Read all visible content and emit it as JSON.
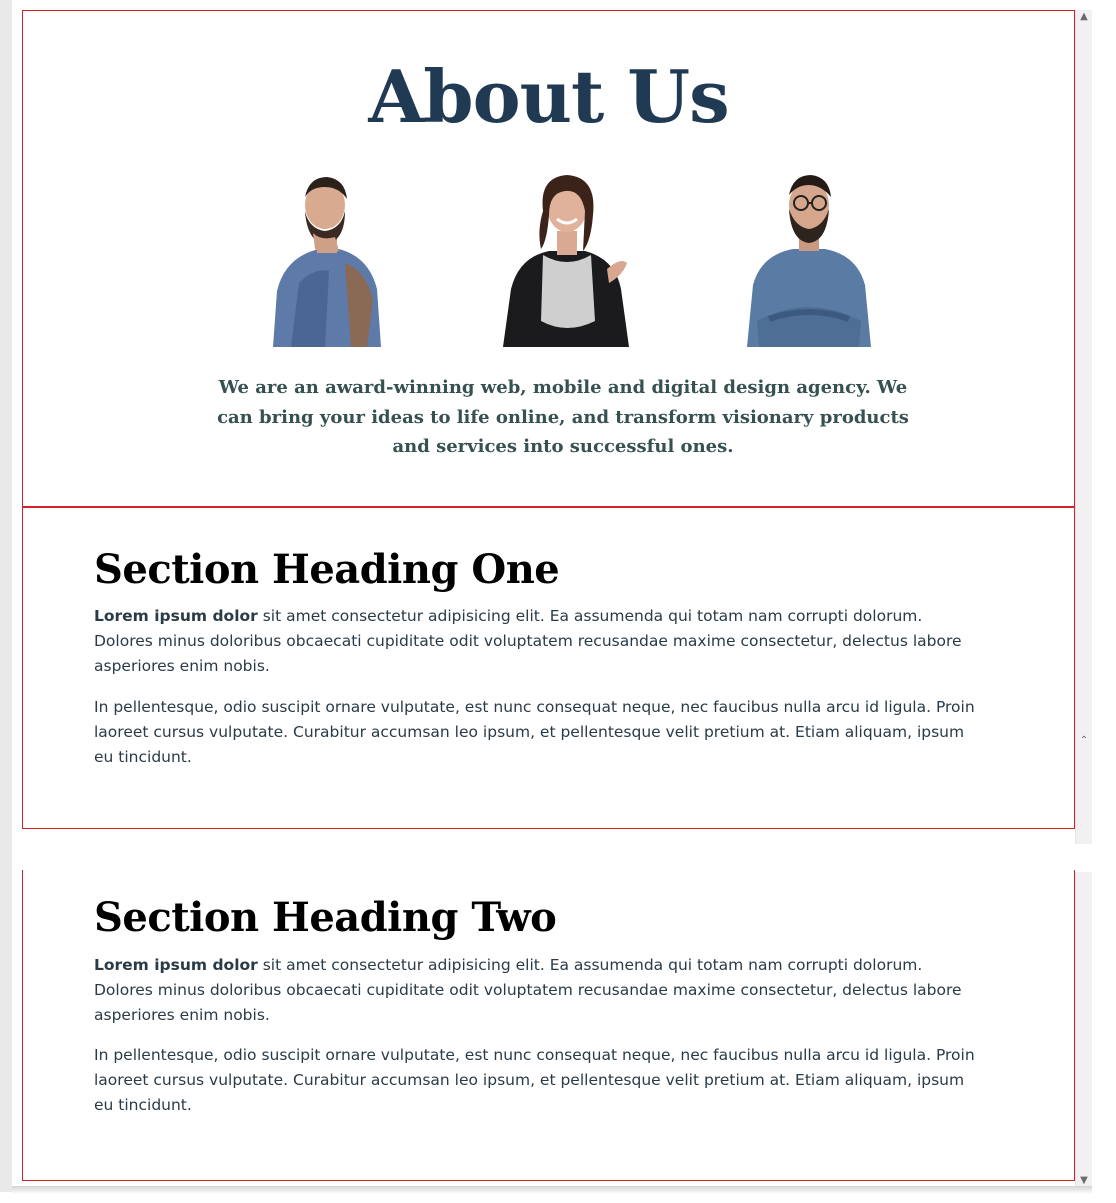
{
  "hero": {
    "title": "About Us",
    "intro": "We are an award-winning web, mobile and digital design agency. We can bring your ideas to life online, and transform visionary products and services into successful ones.",
    "team": [
      {
        "name": "team-member-1"
      },
      {
        "name": "team-member-2"
      },
      {
        "name": "team-member-3"
      }
    ]
  },
  "sections": [
    {
      "heading": "Section Heading One",
      "lead_bold": "Lorem ipsum dolor",
      "lead_rest": " sit amet consectetur adipisicing elit. Ea assumenda qui totam nam corrupti dolorum. Dolores minus doloribus obcaecati cupiditate odit voluptatem recusandae maxime consectetur, delectus labore asperiores enim nobis.",
      "para2": "In pellentesque, odio suscipit ornare vulputate, est nunc consequat neque, nec faucibus nulla arcu id ligula. Proin laoreet cursus vulputate. Curabitur accumsan leo ipsum, et pellentesque velit pretium at. Etiam aliquam, ipsum eu tincidunt."
    },
    {
      "heading": "Section Heading Two",
      "lead_bold": "Lorem ipsum dolor",
      "lead_rest": " sit amet consectetur adipisicing elit. Ea assumenda qui totam nam corrupti dolorum. Dolores minus doloribus obcaecati cupiditate odit voluptatem recusandae maxime consectetur, delectus labore asperiores enim nobis.",
      "para2": "In pellentesque, odio suscipit ornare vulputate, est nunc consequat neque, nec faucibus nulla arcu id ligula. Proin laoreet cursus vulputate. Curabitur accumsan leo ipsum, et pellentesque velit pretium at. Etiam aliquam, ipsum eu tincidunt."
    }
  ],
  "scrollbar": {
    "up_icon": "chevron-up-icon",
    "down_icon": "chevron-down-icon"
  },
  "colors": {
    "title": "#1f3a52",
    "intro": "#365150",
    "border": "#d72027",
    "body_text": "#2a3b47"
  }
}
